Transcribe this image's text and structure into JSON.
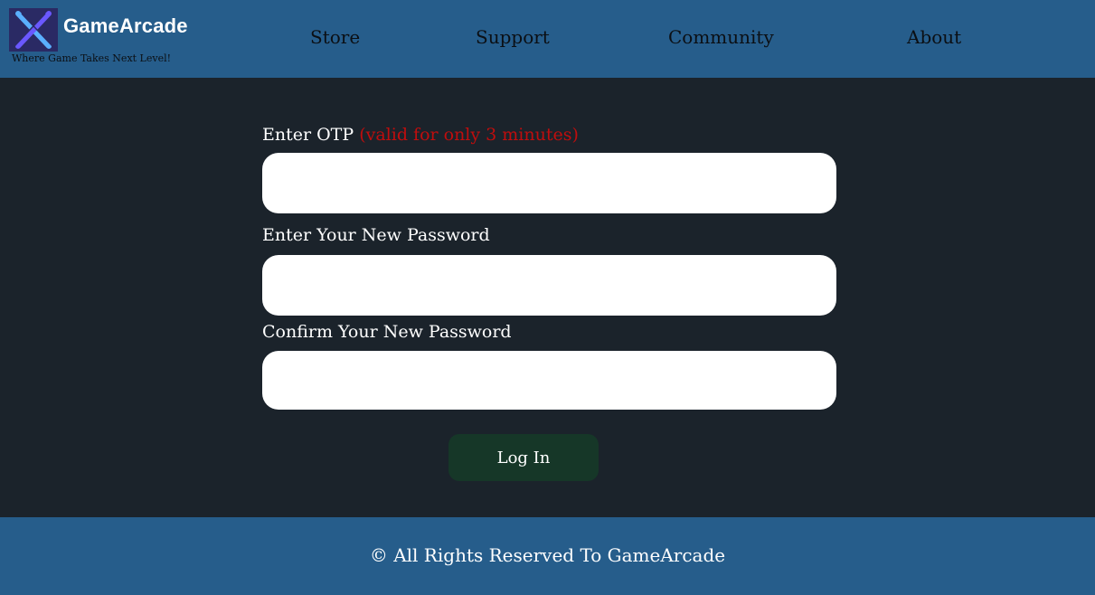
{
  "header": {
    "brand_name": "GameArcade",
    "tagline": "Where Game Takes Next Level!",
    "nav": [
      {
        "label": "Store"
      },
      {
        "label": "Support"
      },
      {
        "label": "Community"
      },
      {
        "label": "About"
      }
    ]
  },
  "form": {
    "otp_label": "Enter OTP",
    "otp_note": "(valid for only 3 minutes)",
    "otp_value": "",
    "new_password_label": "Enter Your New Password",
    "new_password_value": "",
    "confirm_password_label": "Confirm Your New Password",
    "confirm_password_value": "",
    "submit_label": "Log In"
  },
  "footer": {
    "copyright": "© All Rights Reserved To GameArcade"
  },
  "colors": {
    "header_bg": "#265d8b",
    "page_bg": "#1b232b",
    "note_red": "#c00d0d",
    "button_bg": "#163728"
  },
  "icons": {
    "logo": "crossed-swords-x-logo-icon"
  }
}
